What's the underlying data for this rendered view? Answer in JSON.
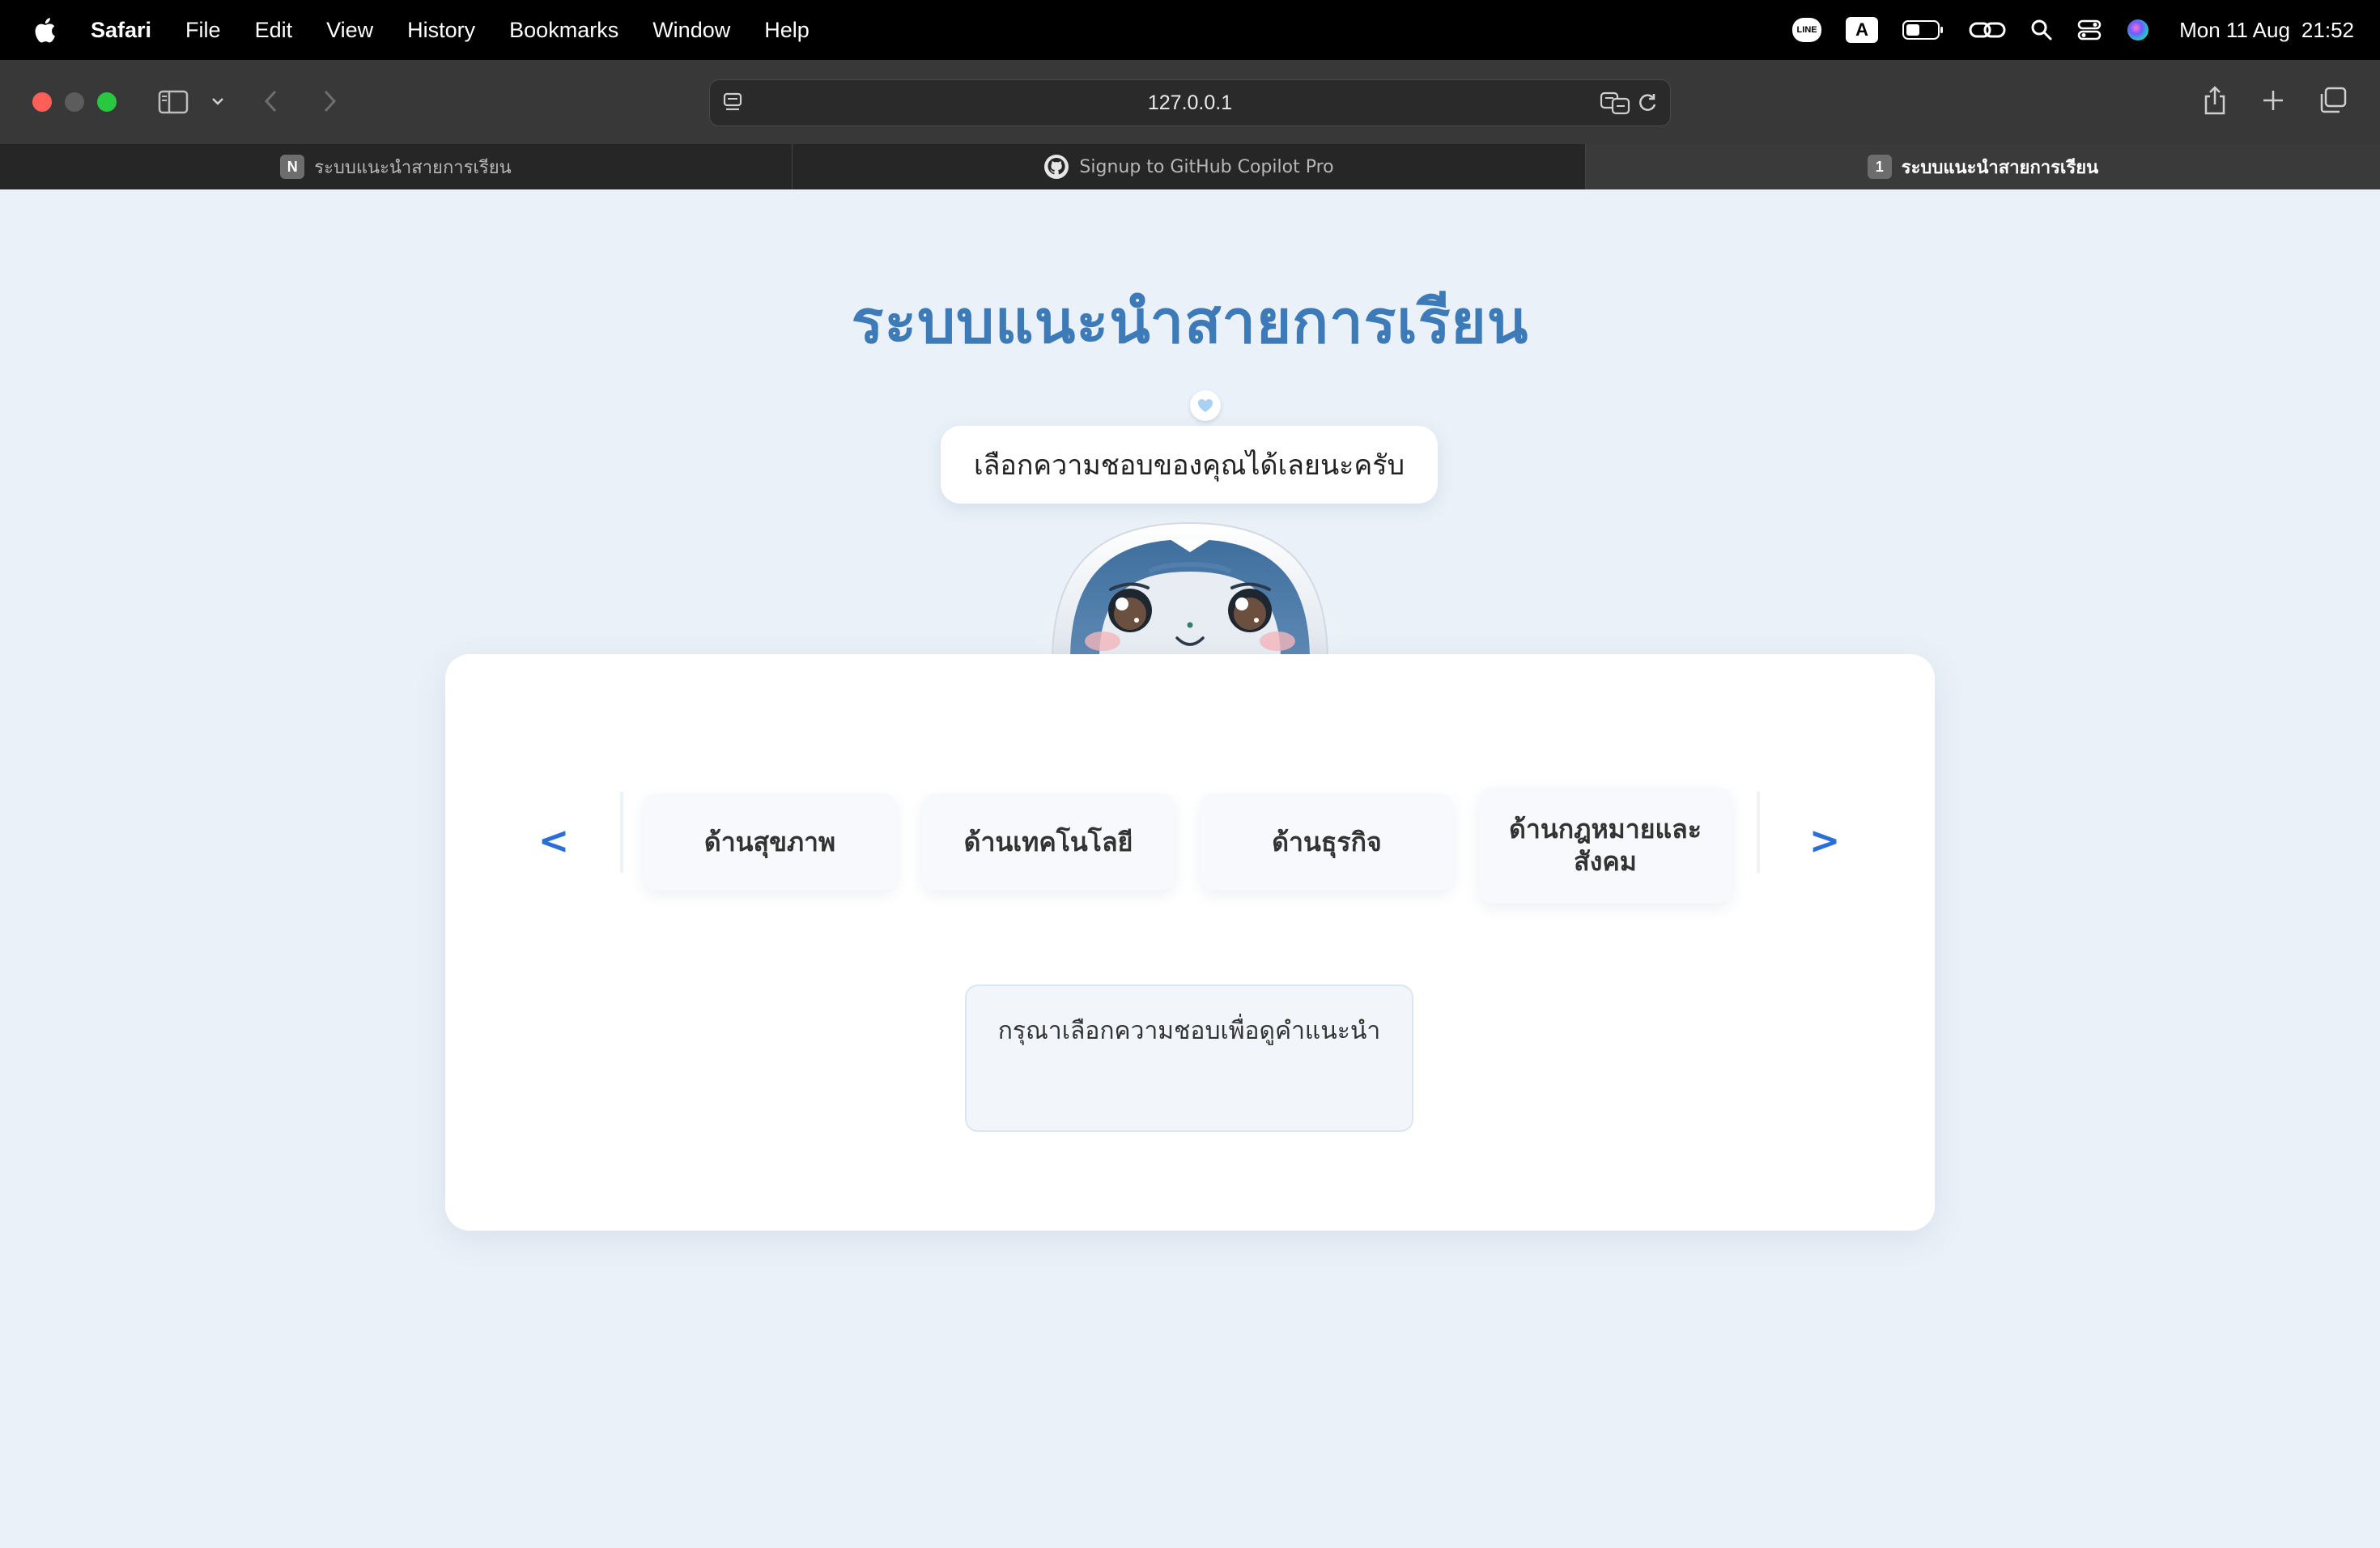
{
  "menubar": {
    "app_name": "Safari",
    "menus": [
      "File",
      "Edit",
      "View",
      "History",
      "Bookmarks",
      "Window",
      "Help"
    ],
    "line_badge": "LINE",
    "input_source": "A",
    "clock": {
      "date": "Mon 11 Aug",
      "time": "21:52"
    }
  },
  "browser": {
    "url": "127.0.0.1",
    "tabs": [
      {
        "title": "ระบบแนะนำสายการเรียน",
        "favicon": "N",
        "active": false
      },
      {
        "title": "Signup to GitHub Copilot Pro",
        "favicon": "github-icon",
        "active": false
      },
      {
        "title": "ระบบแนะนำสายการเรียน",
        "favicon": "1",
        "active": true
      }
    ]
  },
  "page": {
    "title": "ระบบแนะนำสายการเรียน",
    "speech_bubble": "เลือกความชอบของคุณได้เลยนะครับ",
    "carousel": {
      "prev_label": "<",
      "next_label": ">",
      "options": [
        "ด้านสุขภาพ",
        "ด้านเทคโนโลยี",
        "ด้านธุรกิจ",
        "ด้านกฎหมายและสังคม"
      ]
    },
    "hint": "กรุณาเลือกความชอบเพื่อดูคำแนะนำ"
  },
  "colors": {
    "accent": "#3d7ab8",
    "arrow": "#2b6fd6",
    "page_bg": "#eaf1f8"
  }
}
